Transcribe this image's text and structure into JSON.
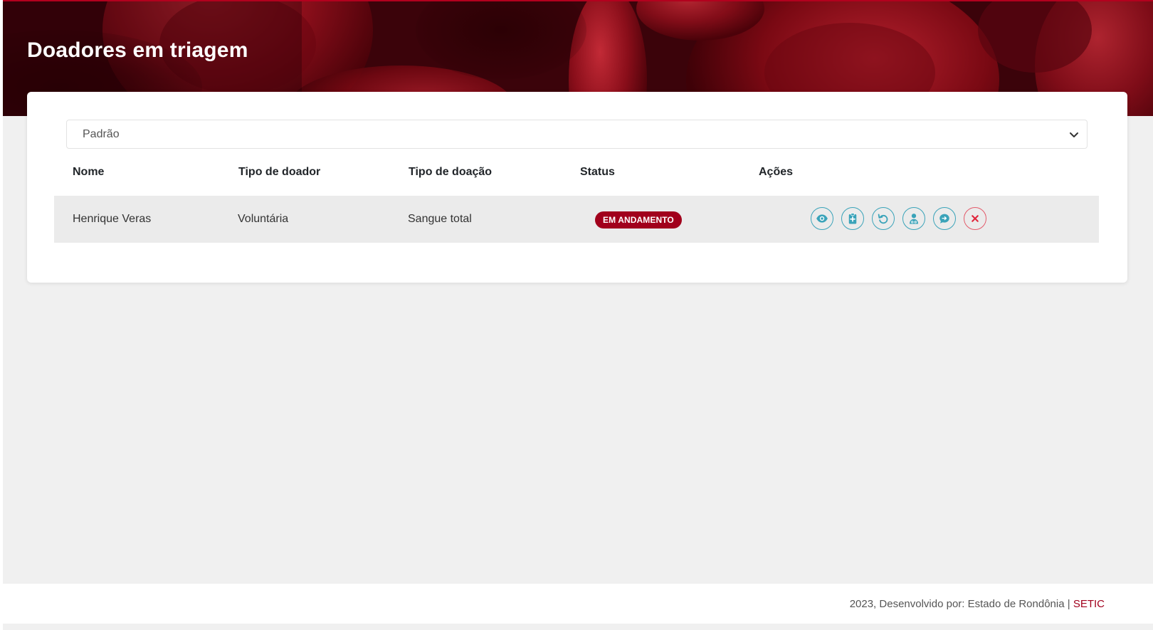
{
  "header": {
    "title": "Doadores em triagem"
  },
  "filter": {
    "selected": "Padrão"
  },
  "table": {
    "columns": [
      "Nome",
      "Tipo de doador",
      "Tipo de doação",
      "Status",
      "Ações"
    ],
    "rows": [
      {
        "nome": "Henrique Veras",
        "tipo_doador": "Voluntária",
        "tipo_doacao": "Sangue total",
        "status": "EM ANDAMENTO"
      }
    ]
  },
  "actions": [
    {
      "icon": "eye-icon"
    },
    {
      "icon": "clipboard-plus-icon"
    },
    {
      "icon": "undo-icon"
    },
    {
      "icon": "doctor-icon"
    },
    {
      "icon": "comment-icon"
    },
    {
      "icon": "close-icon"
    }
  ],
  "colors": {
    "accent": "#a1001c",
    "action": "#3aa3b9",
    "danger": "#e35a6a"
  },
  "footer": {
    "text": "2023, Desenvolvido por: Estado de Rondônia |",
    "link": "SETIC"
  }
}
